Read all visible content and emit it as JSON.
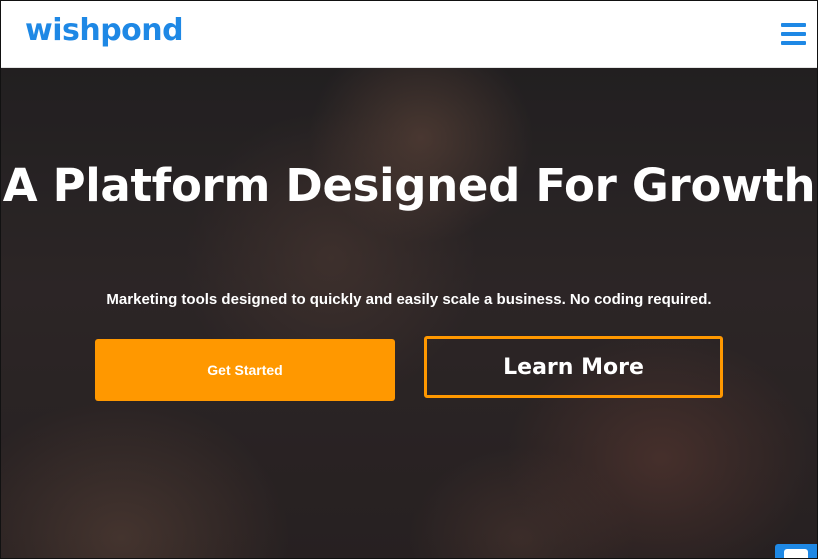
{
  "header": {
    "logo_text": "wishpond",
    "menu_icon": "hamburger-menu-icon"
  },
  "hero": {
    "headline": "A Platform Designed For Growth",
    "subheadline": "Marketing tools designed to quickly and easily scale a business. No coding required.",
    "primary_button_label": "Get Started",
    "secondary_button_label": "Learn More"
  },
  "chat": {
    "icon": "chat-bubble-icon"
  },
  "colors": {
    "brand_blue": "#1e88e5",
    "accent_orange": "#ff9800",
    "text_white": "#ffffff"
  }
}
